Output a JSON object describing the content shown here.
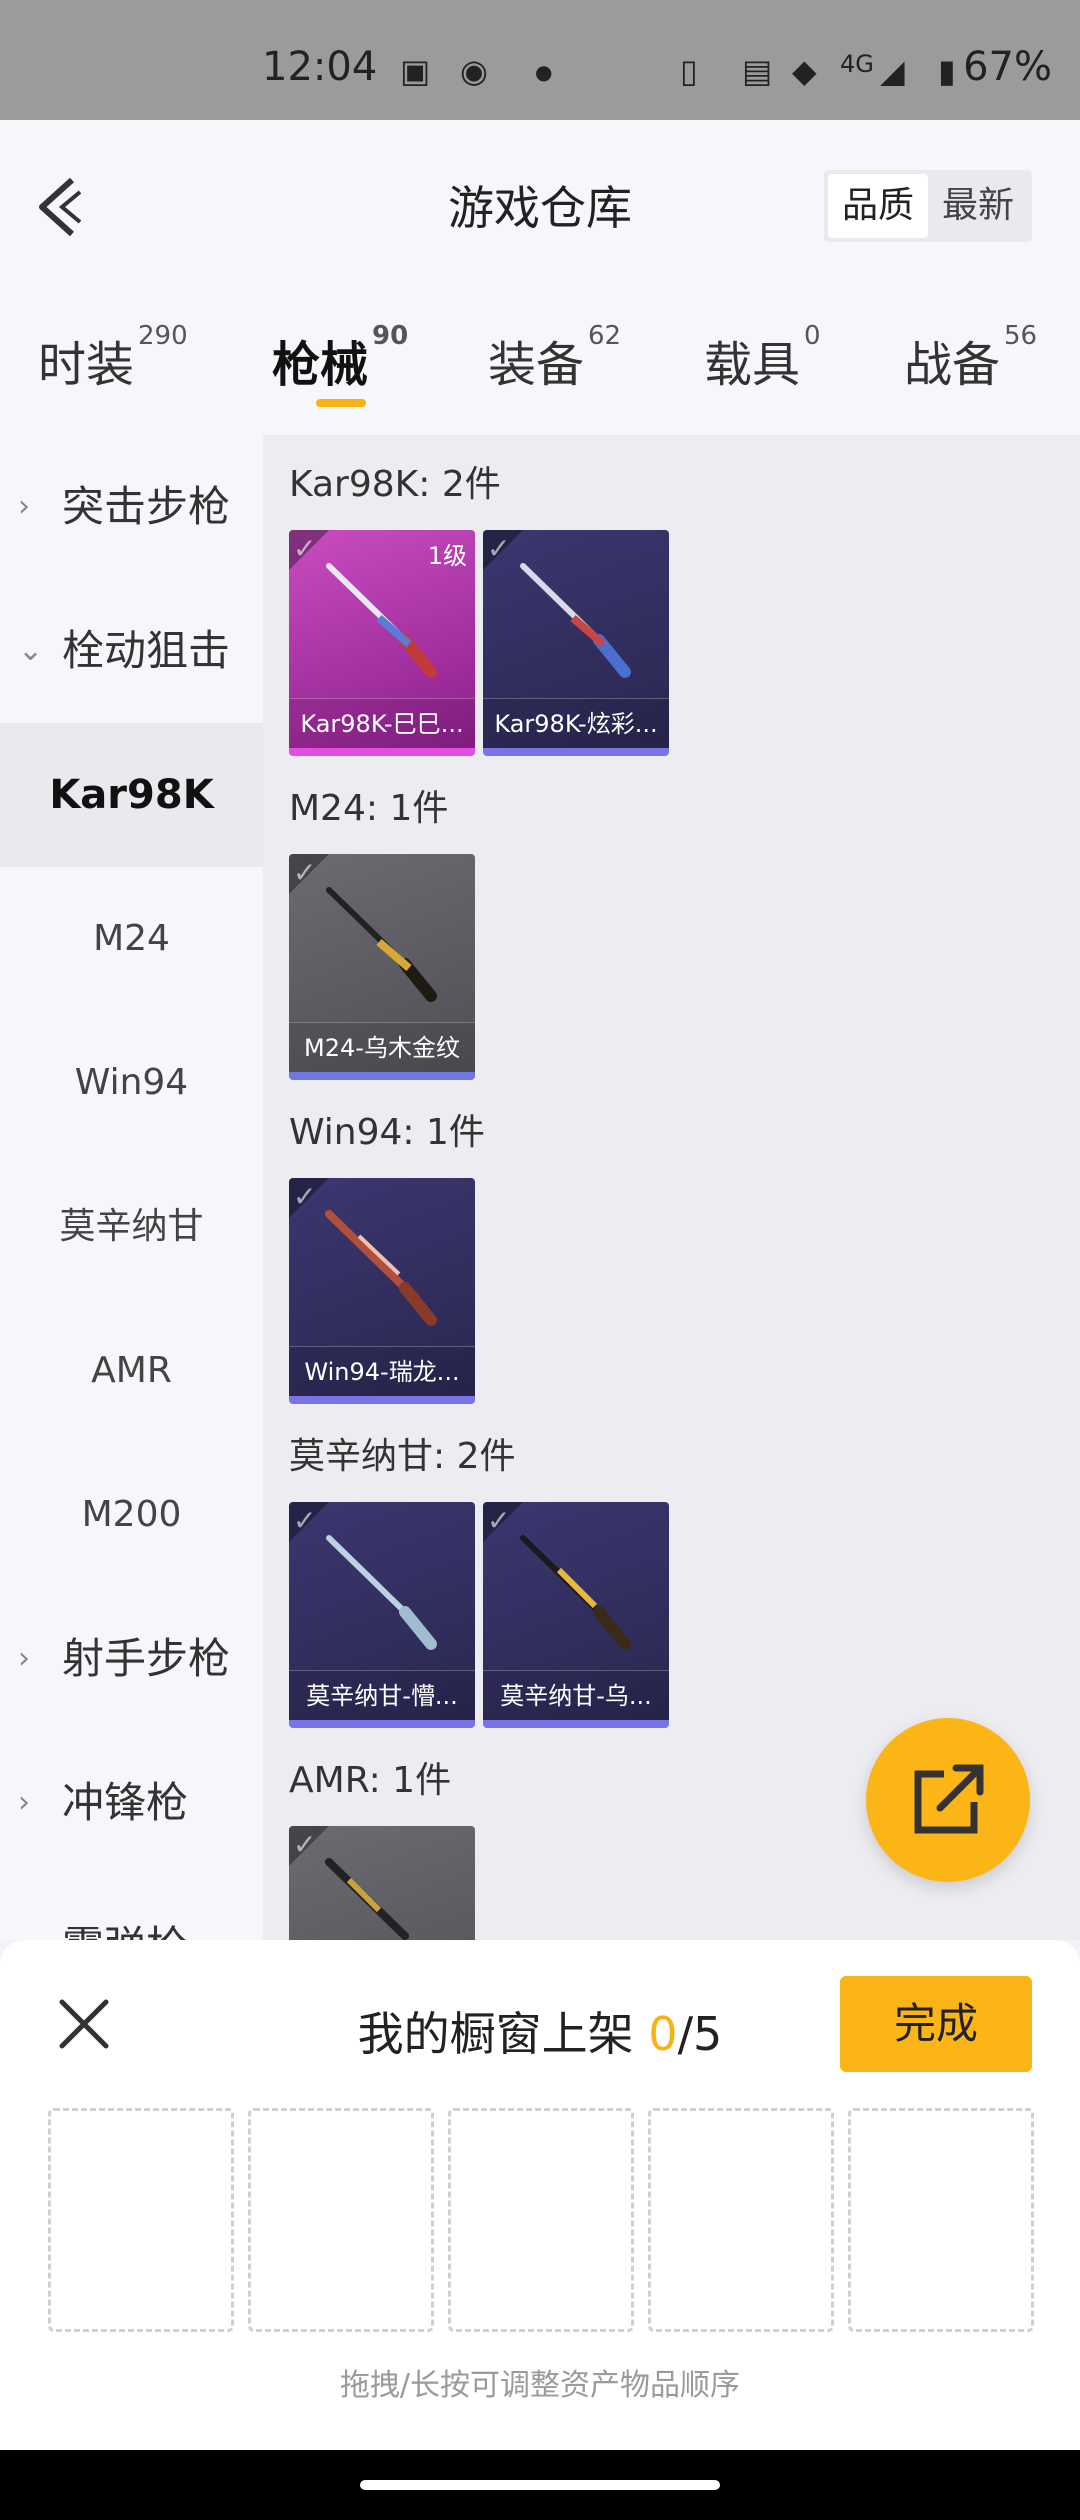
{
  "status": {
    "time": "12:04",
    "network": "4G",
    "battery": "67%"
  },
  "header": {
    "title": "游戏仓库",
    "sort_options": [
      "品质",
      "最新"
    ]
  },
  "tabs": [
    {
      "label": "时装",
      "count": "290"
    },
    {
      "label": "枪械",
      "count": "90"
    },
    {
      "label": "装备",
      "count": "62"
    },
    {
      "label": "载具",
      "count": "0"
    },
    {
      "label": "战备",
      "count": "56"
    }
  ],
  "sidebar": {
    "categories": [
      {
        "label": "突击步枪"
      },
      {
        "label": "栓动狙击"
      }
    ],
    "subitems": [
      {
        "label": "Kar98K"
      },
      {
        "label": "M24"
      },
      {
        "label": "Win94"
      },
      {
        "label": "莫辛纳甘"
      },
      {
        "label": "AMR"
      },
      {
        "label": "M200"
      }
    ],
    "more_categories": [
      {
        "label": "射手步枪"
      },
      {
        "label": "冲锋枪"
      },
      {
        "label": "霰弹枪"
      }
    ]
  },
  "groups": [
    {
      "title": "Kar98K: 2件",
      "items": [
        {
          "name": "Kar98K-巳巳...",
          "level": "1级"
        },
        {
          "name": "Kar98K-炫彩..."
        }
      ]
    },
    {
      "title": "M24: 1件",
      "items": [
        {
          "name": "M24-乌木金纹"
        }
      ]
    },
    {
      "title": "Win94: 1件",
      "items": [
        {
          "name": "Win94-瑞龙..."
        }
      ]
    },
    {
      "title": "莫辛纳甘: 2件",
      "items": [
        {
          "name": "莫辛纳甘-懵..."
        },
        {
          "name": "莫辛纳甘-乌..."
        }
      ]
    },
    {
      "title": "AMR: 1件",
      "items": []
    }
  ],
  "panel": {
    "title": "我的橱窗上架",
    "count": "0",
    "total": "/5",
    "done_label": "完成",
    "hint": "拖拽/长按可调整资产物品顺序"
  },
  "colors": {
    "accent": "#fbb516"
  }
}
